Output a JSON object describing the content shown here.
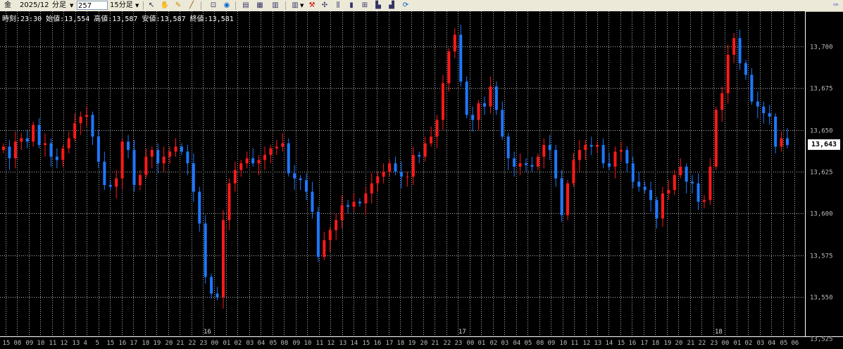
{
  "toolbar": {
    "symbol": "金",
    "contract": "2025/12",
    "bar_type_label": "分足",
    "bar_count_value": "257",
    "interval_label": "15分足",
    "icons": [
      "cursor-icon",
      "hand-icon",
      "pencil-icon",
      "zoom-icon",
      "settings-circle-icon",
      "bar-chart-icon",
      "grid-icon",
      "table-icon",
      "indicator-icon",
      "candle-icon",
      "cross-icon",
      "line-icon",
      "bar-icon",
      "refresh-icon",
      "pin-icon"
    ]
  },
  "info_bar": "時刻:23:30 始値:13,554 高値:13,587 安値:13,587 終値:13,581",
  "current_price": "13,643",
  "colors": {
    "background": "#000000",
    "up": "#ff1a1a",
    "down": "#1e78ff",
    "grid": "#b4b4b4",
    "text": "#ffffff"
  },
  "chart_data": {
    "type": "candlestick",
    "ylim": [
      13525,
      13725
    ],
    "y_ticks": [
      "13,525",
      "13,550",
      "13,575",
      "13,600",
      "13,625",
      "13,650",
      "13,675",
      "13,700"
    ],
    "day_labels": [
      "16",
      "17",
      "18"
    ],
    "x_labels": [
      "15",
      "08",
      "09",
      "10",
      "11",
      "12",
      "13",
      "4",
      "5",
      "15",
      "16",
      "17",
      "18",
      "19",
      "20",
      "21",
      "22",
      "23",
      "00",
      "01",
      "02",
      "03",
      "04",
      "05",
      "08",
      "09",
      "10",
      "11",
      "12",
      "13",
      "14",
      "15",
      "16",
      "17",
      "18",
      "19",
      "20",
      "21",
      "22",
      "23",
      "00",
      "01",
      "02",
      "03",
      "04",
      "05",
      "08",
      "09",
      "10",
      "11",
      "12",
      "13",
      "14",
      "15",
      "16",
      "17",
      "18",
      "19",
      "20",
      "21",
      "22",
      "23",
      "00",
      "01",
      "02",
      "03",
      "04",
      "05",
      "06"
    ],
    "closes": [
      13640,
      13633,
      13643,
      13645,
      13643,
      13653,
      13641,
      13642,
      13634,
      13632,
      13639,
      13645,
      13654,
      13658,
      13659,
      13646,
      13631,
      13617,
      13616,
      13621,
      13643,
      13638,
      13617,
      13623,
      13634,
      13638,
      13630,
      13634,
      13637,
      13640,
      13637,
      13630,
      13613,
      13594,
      13562,
      13552,
      13550,
      13596,
      13618,
      13626,
      13630,
      13633,
      13630,
      13632,
      13635,
      13639,
      13640,
      13642,
      13624,
      13621,
      13620,
      13613,
      13601,
      13574,
      13584,
      13590,
      13596,
      13605,
      13604,
      13607,
      13606,
      13612,
      13618,
      13622,
      13625,
      13630,
      13625,
      13622,
      13622,
      13635,
      13634,
      13642,
      13646,
      13656,
      13678,
      13697,
      13707,
      13679,
      13659,
      13656,
      13666,
      13664,
      13676,
      13662,
      13646,
      13633,
      13628,
      13630,
      13629,
      13628,
      13634,
      13641,
      13638,
      13621,
      13599,
      13618,
      13632,
      13638,
      13641,
      13640,
      13641,
      13630,
      13628,
      13637,
      13638,
      13630,
      13619,
      13616,
      13614,
      13608,
      13597,
      13612,
      13614,
      13623,
      13628,
      13619,
      13618,
      13607,
      13608,
      13628,
      13662,
      13672,
      13695,
      13705,
      13690,
      13683,
      13667,
      13664,
      13660,
      13658,
      13640,
      13645,
      13641
    ]
  }
}
